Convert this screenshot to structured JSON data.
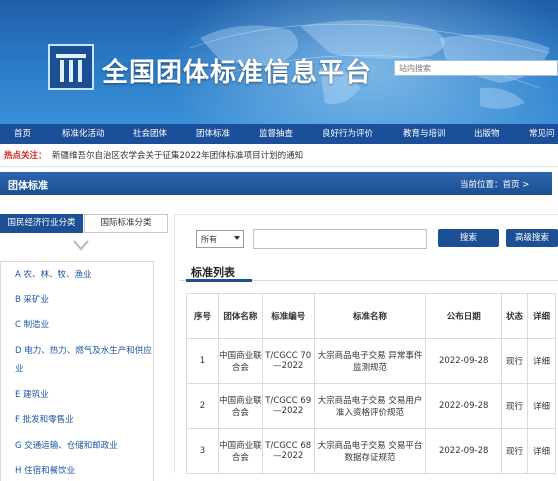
{
  "site": {
    "title": "全国团体标准信息平台",
    "search_placeholder": "站内搜索"
  },
  "nav": [
    "首页",
    "标准化活动",
    "社会团体",
    "团体标准",
    "监督抽查",
    "良好行为评价",
    "教育与培训",
    "出版物",
    "常见问"
  ],
  "hot": {
    "label": "热点关注：",
    "text": "新疆维吾尔自治区农学会关于征集2022年团体标准项目计划的通知"
  },
  "section": {
    "title": "团体标准",
    "breadcrumb": "当前位置：首页 >"
  },
  "left_tabs": {
    "active": "国民经济行业分类",
    "inactive": "国际标准分类"
  },
  "categories": [
    "A 农、林、牧、渔业",
    "B 采矿业",
    "C 制造业",
    "D 电力、热力、燃气及水生产和供应",
    "业",
    "E 建筑业",
    "F 批发和零售业",
    "G 交通运输、仓储和邮政业",
    "H 住宿和餐饮业"
  ],
  "filter": {
    "select_value": "所有",
    "search_button": "搜索",
    "advanced_button": "高级搜索"
  },
  "list": {
    "title": "标准列表",
    "headers": [
      "序号",
      "团体名称",
      "标准编号",
      "标准名称",
      "公布日期",
      "状态",
      "详细"
    ],
    "rows": [
      {
        "no": "1",
        "org": "中国商业联合会",
        "code": "T/CGCC 70—2022",
        "name": "大宗商品电子交易 异常事件监测规范",
        "date": "2022-09-28",
        "status": "现行",
        "detail": "详细"
      },
      {
        "no": "2",
        "org": "中国商业联合会",
        "code": "T/CGCC 69—2022",
        "name": "大宗商品电子交易 交易用户准入资格评价规范",
        "date": "2022-09-28",
        "status": "现行",
        "detail": "详细"
      },
      {
        "no": "3",
        "org": "中国商业联合会",
        "code": "T/CGCC 68—2022",
        "name": "大宗商品电子交易 交易平台数据存证规范",
        "date": "2022-09-28",
        "status": "现行",
        "detail": "详细"
      }
    ]
  },
  "colors": {
    "brand_blue": "#1c4f93",
    "hot_red": "#d0231d",
    "link_blue": "#1c56a8"
  }
}
